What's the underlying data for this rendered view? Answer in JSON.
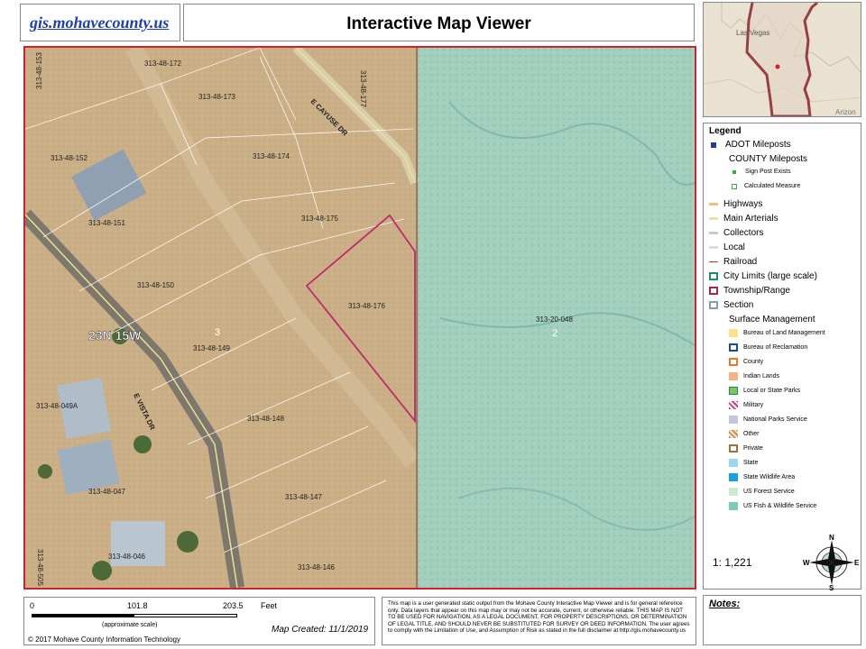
{
  "header": {
    "link": "gis.mohavecounty.us",
    "title": "Interactive Map Viewer"
  },
  "inset": {
    "city1": "Las Vegas",
    "city2": "Arizon"
  },
  "map": {
    "parcels": [
      "313-48-172",
      "313-48-173",
      "313-48-177",
      "313-48-153",
      "313-48-152",
      "313-48-174",
      "313-48-175",
      "313-48-151",
      "313-48-150",
      "313-48-176",
      "313-48-149",
      "313-48-148",
      "313-48-147",
      "313-48-146",
      "313-48-049A",
      "313-48-047",
      "313-48-046",
      "313-48-505",
      "313-20-048"
    ],
    "roads": [
      "E CAYUSE DR",
      "E VISTA DR"
    ],
    "township": "23N 15W",
    "sections": [
      "3",
      "2"
    ]
  },
  "legend": {
    "title": "Legend",
    "items": [
      {
        "label": "ADOT Mileposts",
        "color": "#1c3f94",
        "kind": "dot"
      },
      {
        "label": "COUNTY Mileposts",
        "color": "",
        "kind": "none"
      },
      {
        "label": "Sign Post Exists",
        "color": "#35b03b",
        "kind": "dotsm"
      },
      {
        "label": "Calculated Measure",
        "color": "#35b03b",
        "kind": "dotring"
      },
      {
        "label": "Highways",
        "color": "#e8c37a",
        "kind": "line"
      },
      {
        "label": "Main Arterials",
        "color": "#e8e4a6",
        "kind": "line"
      },
      {
        "label": "Collectors",
        "color": "#c9c9c9",
        "kind": "line"
      },
      {
        "label": "Local",
        "color": "#dcdcdc",
        "kind": "line"
      },
      {
        "label": "Railroad",
        "color": "#c0392b",
        "kind": "rail"
      },
      {
        "label": "City Limits (large scale)",
        "color": "#1e8a6a",
        "kind": "outline"
      },
      {
        "label": "Township/Range",
        "color": "#a0284a",
        "kind": "dashed"
      },
      {
        "label": "Section",
        "color": "#8a9aa8",
        "kind": "outline"
      },
      {
        "label": "Surface Management",
        "color": "",
        "kind": "none"
      },
      {
        "label": "Bureau of Land Management",
        "color": "#fce08a",
        "kind": "fill"
      },
      {
        "label": "Bureau of Reclamation",
        "color": "#1c4b9c",
        "kind": "outline"
      },
      {
        "label": "County",
        "color": "#e57a2b",
        "kind": "outline"
      },
      {
        "label": "Indian Lands",
        "color": "#f4b582",
        "kind": "fill"
      },
      {
        "label": "Local or State Parks",
        "color": "#7ec850",
        "kind": "fillb"
      },
      {
        "label": "Military",
        "color": "#d23a6a",
        "kind": "hatch"
      },
      {
        "label": "National Parks Service",
        "color": "#c2c4e4",
        "kind": "fill"
      },
      {
        "label": "Other",
        "color": "#c8904a",
        "kind": "hatch2"
      },
      {
        "label": "Private",
        "color": "#a07040",
        "kind": "outline"
      },
      {
        "label": "State",
        "color": "#9fd6ef",
        "kind": "fill"
      },
      {
        "label": "State Wildlife Area",
        "color": "#1a9fe0",
        "kind": "fill"
      },
      {
        "label": "US Forest Service",
        "color": "#c9ebd2",
        "kind": "fill"
      },
      {
        "label": "US Fish & Wildlife Service",
        "color": "#7ccbb8",
        "kind": "fill"
      }
    ],
    "scale": "1: 1,221",
    "compass": {
      "n": "N",
      "s": "S",
      "e": "E",
      "w": "W"
    }
  },
  "scalebar": {
    "t0": "0",
    "t1": "101.8",
    "t2": "203.5",
    "unit": "Feet",
    "approx": "(approximate scale)"
  },
  "created": "Map Created: 11/1/2019",
  "copyright": "© 2017 Mohave County Information Technology",
  "disclaimer": "This map is a user generated static output from the Mohave County Interactive Map Viewer and is for general reference only. Data layers that appear on this map may or may not be accurate, current, or otherwise reliable. THIS MAP IS NOT TO BE USED FOR NAVIGATION, AS A LEGAL DOCUMENT, FOR PROPERTY DESCRIPTIONS, OR DETERMINATION OF LEGAL TITLE, AND SHOULD NEVER BE SUBSTITUTED FOR SURVEY OR DEED INFORMATION. The user agrees to comply with the Limitation of Use, and Assumption of Risk as stated in the full disclaimer at http://gis.mohavecounty.us",
  "notes": "Notes:"
}
